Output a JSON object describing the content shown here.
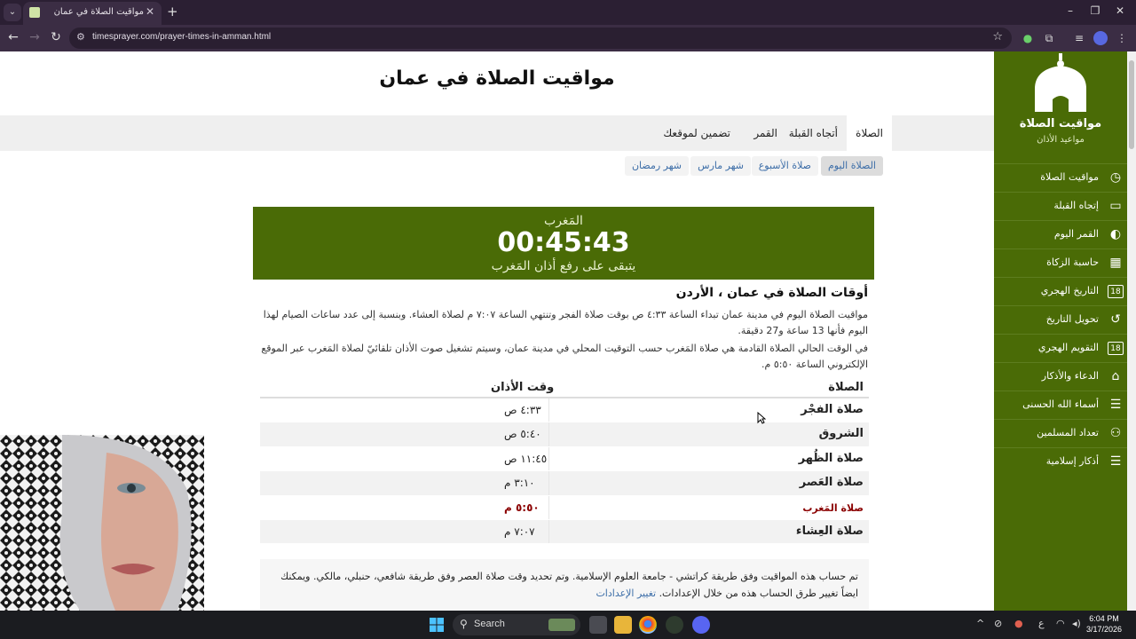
{
  "browser": {
    "tab_title": "مواقيت الصلاة في عمان",
    "url": "timesprayer.com/prayer-times-in-amman.html"
  },
  "page": {
    "title": "مواقيت الصلاة في عمان",
    "main_tabs": [
      {
        "label": "الصلاة",
        "active": true
      },
      {
        "label": "أتجاه القبلة",
        "active": false
      },
      {
        "label": "القمر",
        "active": false
      },
      {
        "label": "تضمين لموقعك",
        "active": false
      }
    ],
    "sub_tabs": [
      {
        "label": "الصلاة اليوم",
        "active": true
      },
      {
        "label": "صلاة الأسبوع",
        "active": false
      },
      {
        "label": "شهر مارس",
        "active": false
      },
      {
        "label": "شهر رمضان",
        "active": false
      }
    ],
    "countdown": {
      "prayer": "المَغرب",
      "time": "00:45:43",
      "remaining": "يتبقى على رفع أذان المَغرب"
    },
    "times_heading": "أوقات الصلاة في عمان ، الأردن",
    "paragraph1": "مواقيت الصلاة اليوم في مدينة عمان تبداء الساعة ٤:٣٣ ص بوقت صلاة الفجر وتنتهي الساعة ٧:٠٧ م لصلاة العشاء. وبنسبة إلى عدد ساعات الصيام لهذا اليوم فأنها 13 ساعة و27 دقيقة.",
    "paragraph2": "في الوقت الحالي الصلاة القادمة هي صلاة المَغرب حسب التوقيت المحلي في مدينة عمان، وسيتم تشغيل صوت الأذان تلقائيّ لصلاة المَغرب عبر الموقع الإلكتروني الساعة ٥:٥٠ م.",
    "table": {
      "col_prayer": "الصلاة",
      "col_time": "وقت الأذان",
      "rows": [
        {
          "name": "صلاة الفجْر",
          "time": "٤:٣٣ ص"
        },
        {
          "name": "الشروق",
          "time": "٥:٤٠ ص"
        },
        {
          "name": "صلاة الظُهر",
          "time": "١١:٤٥ ص"
        },
        {
          "name": "صلاة العَصر",
          "time": "٣:١٠ م"
        },
        {
          "name": "صلاة المَغرب",
          "time": "٥:٥٠ م"
        },
        {
          "name": "صلاة العِشاء",
          "time": "٧:٠٧ م"
        }
      ]
    },
    "method_text": "تم حساب هذه المواقيت وفق طريقة كراتشي - جامعة العلوم الإسلامية. وتم تحديد وقت صلاة العصر وفق طريقة شافعي، حنبلي، مالكي. ويمكنك ايضاً تغيير طرق الحساب هذه من خلال الإعدادات.",
    "settings_link": "تغيير الإعدادات"
  },
  "sidebar": {
    "title": "مواقيت الصلاة",
    "subtitle": "مواعيد الأذان",
    "items": [
      {
        "label": "مواقيت الصلاة",
        "icon": "clock-icon",
        "glyph": "◷"
      },
      {
        "label": "إتجاه القبلة",
        "icon": "kaaba-icon",
        "glyph": "▭"
      },
      {
        "label": "القمر اليوم",
        "icon": "moon-icon",
        "glyph": "◐"
      },
      {
        "label": "حاسبة الزكاة",
        "icon": "calculator-icon",
        "glyph": "▦"
      },
      {
        "label": "التاريخ الهجري",
        "icon": "calendar-icon",
        "glyph": "18"
      },
      {
        "label": "تحويل التاريخ",
        "icon": "history-icon",
        "glyph": "↺"
      },
      {
        "label": "التقويم الهجري",
        "icon": "calendar-icon",
        "glyph": "18"
      },
      {
        "label": "الدعاء والأذكار",
        "icon": "mosque-icon",
        "glyph": "⌂"
      },
      {
        "label": "أسماء الله الحسنى",
        "icon": "list-icon",
        "glyph": "☰"
      },
      {
        "label": "تعداد المسلمين",
        "icon": "people-icon",
        "glyph": "⚇"
      },
      {
        "label": "أذكار إسلامية",
        "icon": "list-icon",
        "glyph": "☰"
      }
    ]
  },
  "taskbar": {
    "search_label": "Search",
    "tray_lang": "ع",
    "time": "6:04 PM",
    "date": "3/17/2026"
  },
  "colors": {
    "brand_green": "#4a6b06",
    "link_blue": "#3d6ea8",
    "highlight_red": "#8b0000"
  }
}
